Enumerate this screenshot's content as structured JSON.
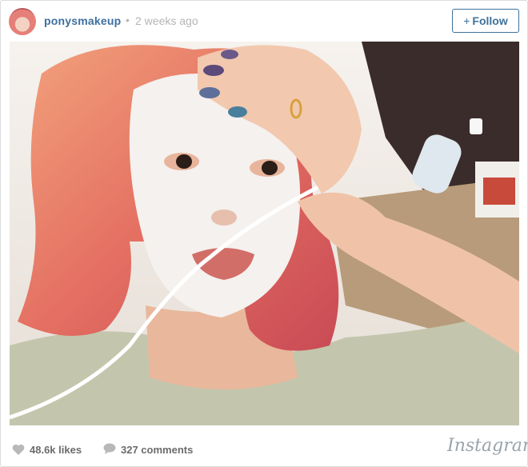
{
  "post": {
    "username": "ponysmakeup",
    "separator": "•",
    "time_ago": "2 weeks ago",
    "follow_label": "Follow",
    "follow_plus": "+",
    "likes": "48.6k likes",
    "comments": "327 comments",
    "brand": "Instagram"
  },
  "icons": {
    "avatar": "profile-avatar",
    "likes": "heart-icon",
    "comments": "speech-bubble-icon"
  },
  "colors": {
    "username": "#3d6fa0",
    "follow_accent": "#3f729b",
    "muted": "#b5b5b5",
    "footer_text": "#6b6b6b",
    "brand": "#9aa3ab",
    "hair": "#e47a66",
    "mask": "#f4f1ee"
  }
}
